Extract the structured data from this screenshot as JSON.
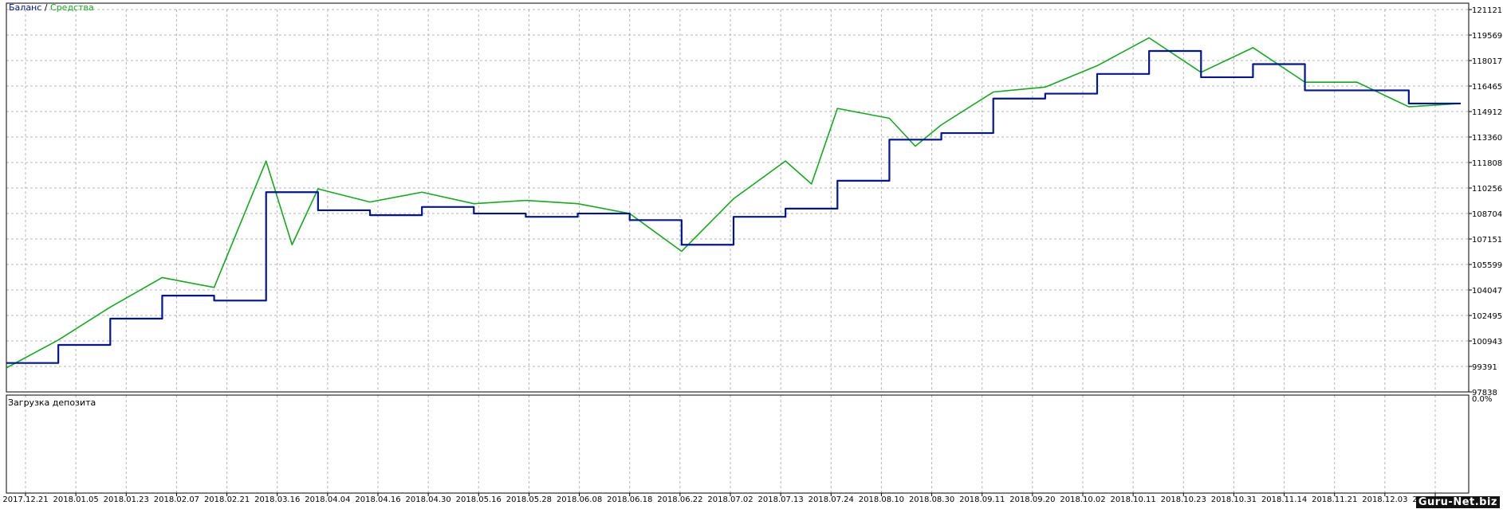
{
  "legend": {
    "balance": "Баланс",
    "separator": " / ",
    "equity": "Средства"
  },
  "colors": {
    "balance": "#00149c",
    "equity": "#0fae18",
    "grid": "#b4b4b4",
    "frame": "#000000"
  },
  "subchart": {
    "title": "Загрузка депозита",
    "value_label": "0.0%"
  },
  "watermark": "Guru-Net.biz",
  "chart_data": {
    "type": "line",
    "title": "",
    "ylim": [
      97838,
      121121
    ],
    "y_ticks": [
      121121,
      119569,
      118017,
      116465,
      114912,
      113360,
      111808,
      110256,
      108704,
      107151,
      105599,
      104047,
      102495,
      100943,
      99391,
      97838
    ],
    "x_ticks": [
      "2017.12.21",
      "2018.01.05",
      "2018.01.23",
      "2018.02.07",
      "2018.02.21",
      "2018.03.16",
      "2018.04.04",
      "2018.04.16",
      "2018.04.30",
      "2018.05.16",
      "2018.05.28",
      "2018.06.08",
      "2018.06.18",
      "2018.06.22",
      "2018.07.02",
      "2018.07.13",
      "2018.07.24",
      "2018.08.10",
      "2018.08.30",
      "2018.09.11",
      "2018.09.20",
      "2018.10.02",
      "2018.10.11",
      "2018.10.23",
      "2018.10.31",
      "2018.11.14",
      "2018.11.21",
      "2018.12.03",
      "2018.12.12"
    ],
    "balance_series": {
      "name": "Баланс",
      "trades": [
        0,
        10,
        20,
        30,
        40,
        50,
        60,
        70,
        80,
        90,
        100,
        110,
        120,
        130,
        140,
        150,
        160,
        170,
        180,
        190,
        200,
        210,
        220,
        230,
        240,
        250,
        260,
        270,
        280
      ],
      "values": [
        99600,
        100700,
        102300,
        103700,
        103400,
        110000,
        108900,
        108600,
        109100,
        108700,
        108500,
        108700,
        108300,
        106800,
        108500,
        109000,
        110700,
        113200,
        113600,
        115700,
        116000,
        117200,
        118600,
        117000,
        117800,
        116200,
        116200,
        115400,
        115400
      ]
    },
    "equity_series": {
      "name": "Средства",
      "trades": [
        0,
        10,
        20,
        30,
        40,
        50,
        55,
        60,
        70,
        80,
        90,
        100,
        110,
        120,
        130,
        140,
        150,
        155,
        160,
        170,
        175,
        180,
        190,
        200,
        210,
        220,
        230,
        240,
        250,
        260,
        270,
        280
      ],
      "values": [
        99300,
        101000,
        103000,
        104800,
        104200,
        111900,
        106800,
        110200,
        109400,
        110000,
        109300,
        109500,
        109300,
        108700,
        106400,
        109600,
        111900,
        110500,
        115100,
        114500,
        112800,
        114100,
        116100,
        116400,
        117700,
        119400,
        117300,
        118800,
        116700,
        116700,
        115200,
        115400
      ]
    }
  }
}
